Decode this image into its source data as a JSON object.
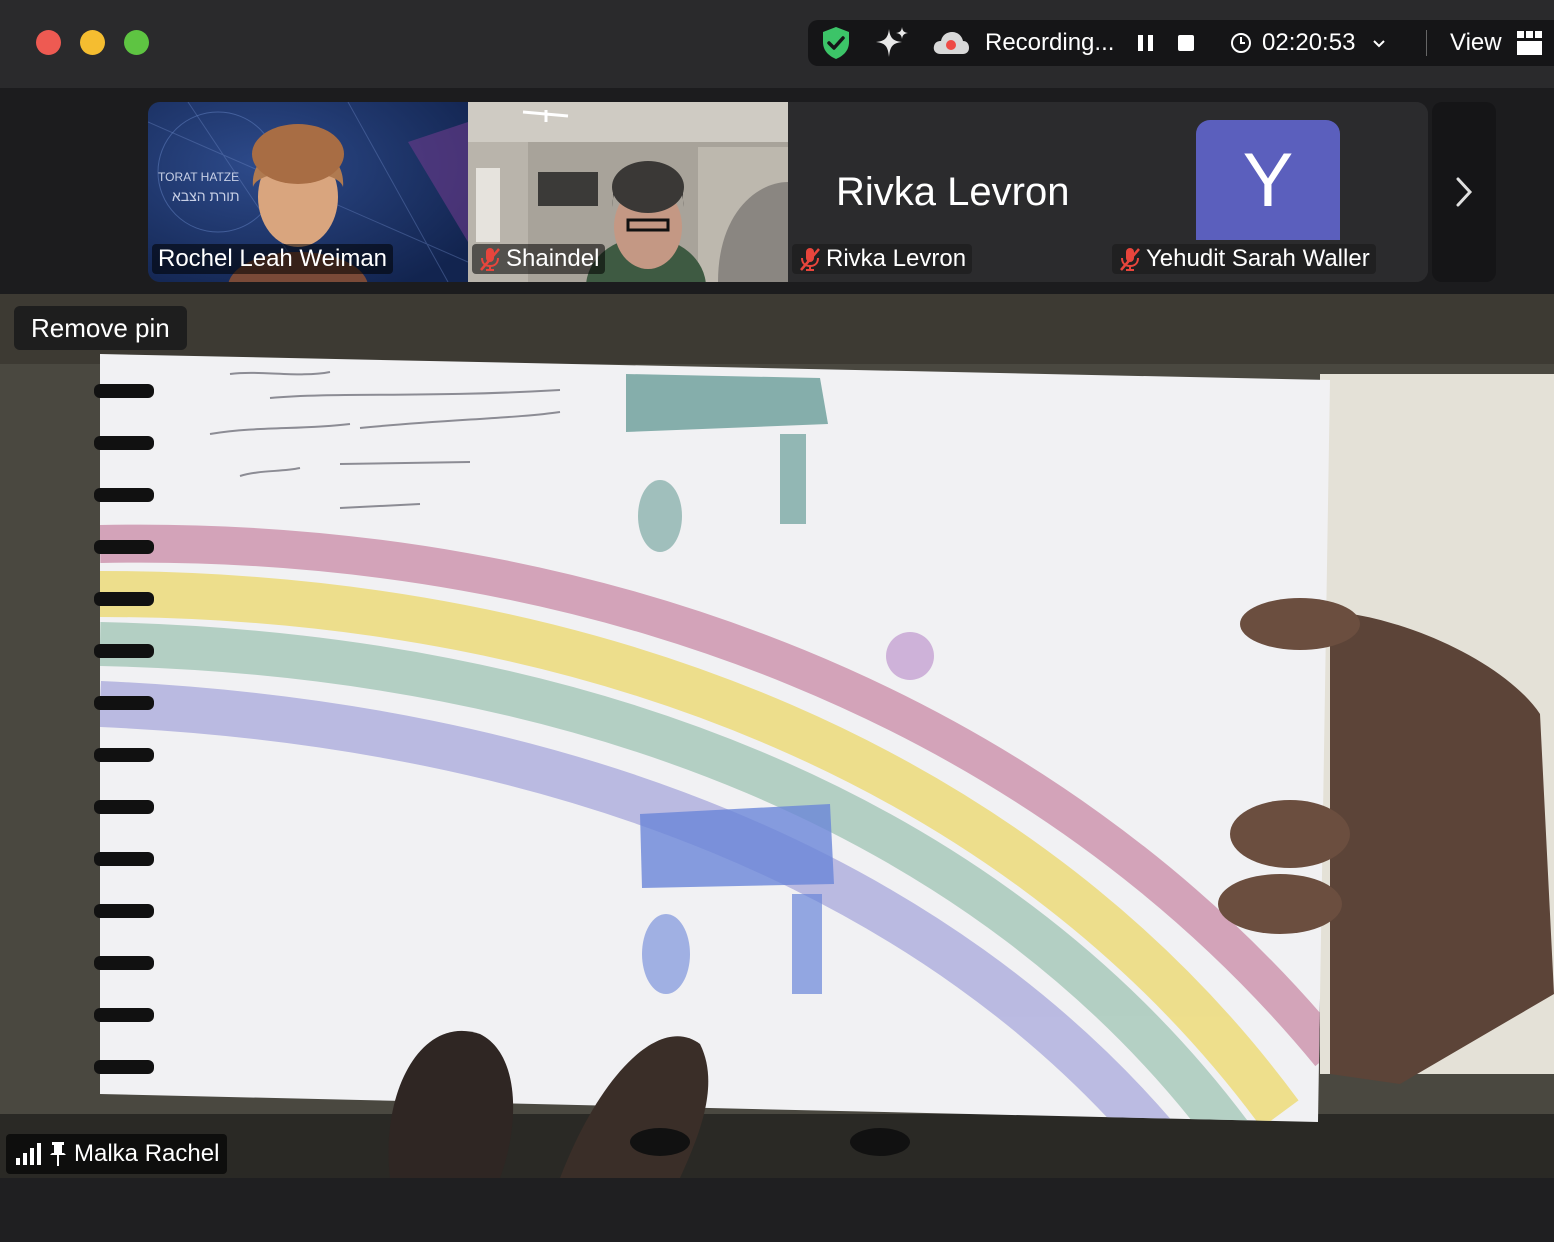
{
  "toolbar": {
    "recording_label": "Recording...",
    "timer": "02:20:53",
    "view_label": "View",
    "icons": [
      "shield-check-icon",
      "sparkle-icon",
      "cloud-record-icon",
      "pause-icon",
      "stop-icon",
      "clock-icon",
      "chevron-down-icon",
      "grid-view-icon"
    ]
  },
  "gallery": {
    "tiles": [
      {
        "name": "Rochel Leah Weiman",
        "muted": false,
        "background_text_1": "TORAT HATZE",
        "background_text_2": "תורת הצבא"
      },
      {
        "name": "Shaindel",
        "muted": true
      },
      {
        "name": "Rivka Levron",
        "muted": true,
        "display_name": "Rivka Levron"
      },
      {
        "name": "Yehudit Sarah Waller",
        "muted": true,
        "avatar_letter": "Y",
        "avatar_color": "#5b5fbd"
      }
    ]
  },
  "main_video": {
    "pin_button_label": "Remove pin",
    "participant_name": "Malka Rachel"
  },
  "colors": {
    "mute_red": "#e8453c",
    "shield_green": "#3cc468",
    "record_red": "#ee4a45"
  }
}
